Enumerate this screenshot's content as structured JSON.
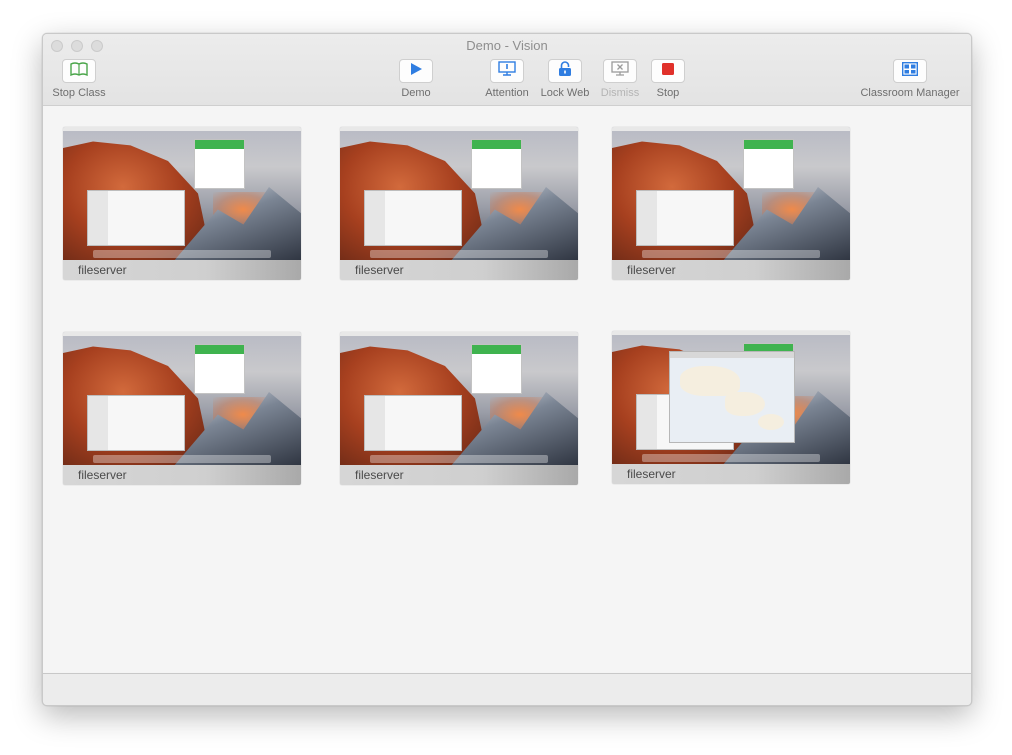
{
  "window": {
    "title": "Demo  -  Vision"
  },
  "toolbar": {
    "stop_class": "Stop Class",
    "demo": "Demo",
    "attention": "Attention",
    "lock_web": "Lock Web",
    "dismiss": "Dismiss",
    "stop": "Stop",
    "classroom_manager": "Classroom Manager"
  },
  "colors": {
    "accent_blue": "#2f7de1",
    "stop_red": "#e0302a",
    "stop_class_green": "#4aa54a",
    "app_green": "#3fb34f"
  },
  "students": [
    {
      "name": "fileserver",
      "screen": "desktop-finder"
    },
    {
      "name": "fileserver",
      "screen": "desktop-finder"
    },
    {
      "name": "fileserver",
      "screen": "desktop-finder"
    },
    {
      "name": "fileserver",
      "screen": "desktop-finder"
    },
    {
      "name": "fileserver",
      "screen": "desktop-finder"
    },
    {
      "name": "fileserver",
      "screen": "desktop-maps"
    }
  ]
}
